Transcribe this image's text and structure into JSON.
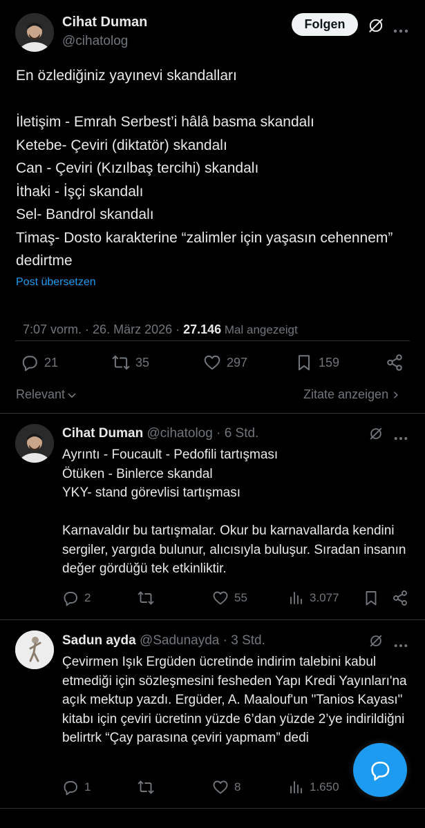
{
  "main_post": {
    "author_name": "Cihat Duman",
    "handle": "@cihatolog",
    "follow_label": "Folgen",
    "text": "En özlediğiniz yayınevi skandalları\n\nİletişim - Emrah Serbest’i hâlâ basma skandalı\nKetebe- Çeviri (diktatör)  skandalı\nCan - Çeviri (Kızılbaş tercihi) skandalı\nİthaki - İşçi skandalı\nSel- Bandrol skandalı\nTimaş- Dosto karakterine “zalimler için yaşasın cehennem” dedirtme",
    "translate_label": "Post übersetzen",
    "timestamp": "7:07 vorm. · 26. März 2026 · ",
    "views_count": "27.146",
    "views_label": " Mal angezeigt",
    "replies": "21",
    "reposts": "35",
    "likes": "297",
    "bookmarks": "159"
  },
  "sort": {
    "relevant_label": "Relevant",
    "quotes_label": "Zitate anzeigen"
  },
  "replies": [
    {
      "author_name": "Cihat Duman",
      "handle": "@cihatolog",
      "time": " · 6 Std.",
      "text": "Ayrıntı - Foucault - Pedofili tartışması\nÖtüken - Binlerce skandal\nYKY- stand görevlisi tartışması\n\nKarnavaldır bu tartışmalar. Okur bu karnavallarda kendini sergiler, yargıda bulunur, alıcısıyla buluşur. Sıradan insanın değer gördüğü tek etkinliktir.",
      "replies": "2",
      "reposts": "",
      "likes": "55",
      "views": "3.077"
    },
    {
      "author_name": "Sadun ayda",
      "handle": "@Sadunayda",
      "time": " · 3 Std.",
      "text": "Çevirmen Işık Ergüden ücretinde indirim talebini kabul etmediği için sözleşmesini  fesheden Yapı Kredi Yayınları'na açık mektup yazdı. Ergüder, A. Maalouf'un \"Tanios Kayası\" kitabı için çeviri ücretinn yüzde 6’dan yüzde 2’ye indirildiğni belirtrk “Çay parasına çeviri yapmam” dedi",
      "replies": "1",
      "reposts": "",
      "likes": "8",
      "views": "1.650"
    }
  ],
  "icons": {
    "grok": "grok-icon",
    "more": "more-icon",
    "reply": "reply-icon",
    "repost": "repost-icon",
    "like": "heart-icon",
    "bookmark": "bookmark-icon",
    "share": "share-icon",
    "views": "views-icon",
    "fab": "compose-reply-icon"
  },
  "colors": {
    "background": "#000000",
    "text": "#e7e9ea",
    "secondary": "#71767b",
    "link": "#1d9bf0",
    "divider": "#2f3336"
  }
}
